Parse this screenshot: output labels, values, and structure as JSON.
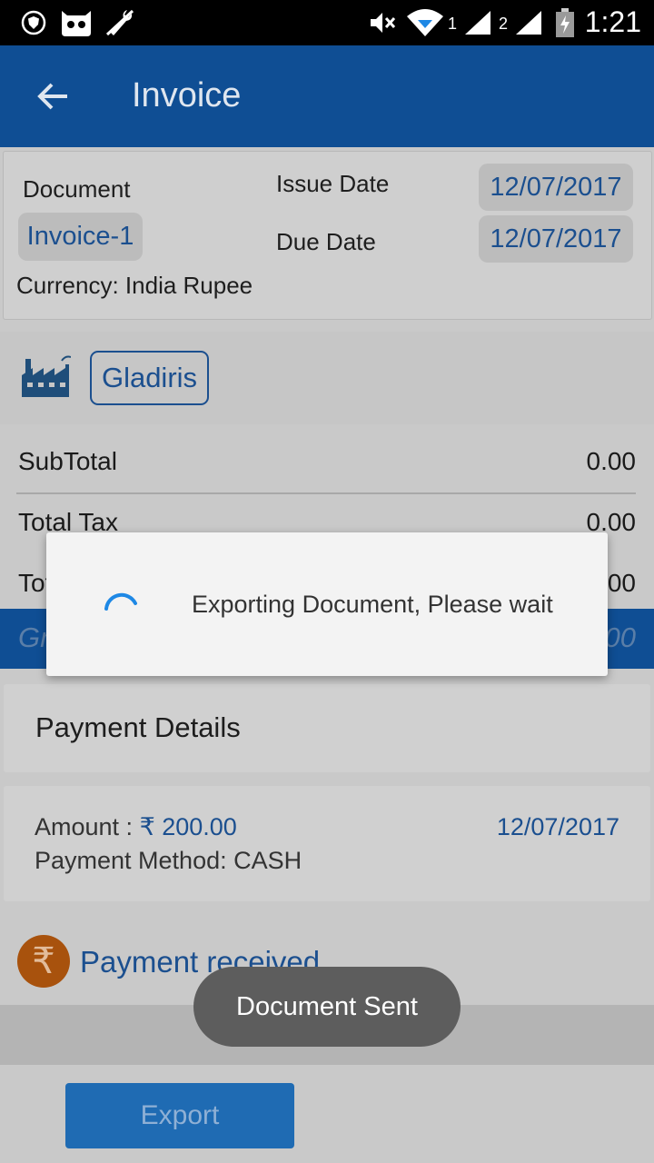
{
  "status_bar": {
    "time": "1:21",
    "sim1_label": "1",
    "sim2_label": "2",
    "icons": [
      "shield-icon",
      "cyanogen-mascot-icon",
      "no-wrench-icon",
      "mute-icon",
      "wifi-icon",
      "signal-icon",
      "battery-icon"
    ]
  },
  "app_bar": {
    "title": "Invoice",
    "back_icon": "arrow-left-icon",
    "color": "#0f4e94"
  },
  "document": {
    "doc_label": "Document",
    "doc_number": "Invoice-1",
    "issue_date_label": "Issue Date",
    "issue_date": "12/07/2017",
    "due_date_label": "Due Date",
    "due_date": "12/07/2017",
    "currency": "Currency: India Rupee"
  },
  "client": {
    "icon": "factory-icon",
    "name": "Gladiris"
  },
  "totals": {
    "subtotal_label": "SubTotal",
    "subtotal_value": "0.00",
    "tax_label": "Total Tax",
    "tax_value": "0.00",
    "paid_label": "Total Paid",
    "paid_value": "0.00",
    "grand_label": "Grand Total",
    "grand_value": "0.00"
  },
  "payment": {
    "header": "Payment Details",
    "amount_label": "Amount : ",
    "amount_value": "₹ 200.00",
    "date": "12/07/2017",
    "method": "Payment Method: CASH"
  },
  "status": {
    "icon_glyph": "₹",
    "text": "Payment received"
  },
  "export_button": "Export",
  "dialog": {
    "message": "Exporting Document, Please wait"
  },
  "toast": "Document Sent",
  "colors": {
    "primary": "#0f4e94",
    "accent_text": "#1b4f8f",
    "rupee_circle": "#a8520d",
    "export_button": "#1f6bb3"
  }
}
